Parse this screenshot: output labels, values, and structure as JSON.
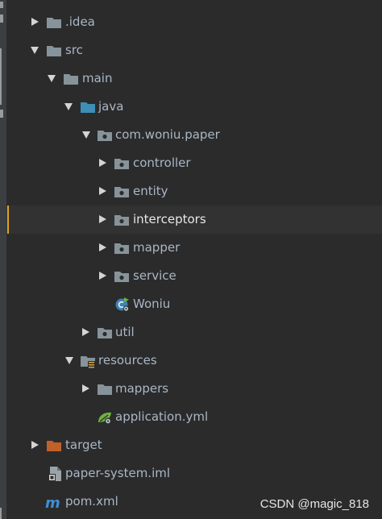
{
  "project_tree": {
    "items": [
      {
        "id": "idea",
        "label": ".idea",
        "expanded": false,
        "icon": "folder-icon"
      },
      {
        "id": "src",
        "label": "src",
        "expanded": true,
        "icon": "folder-icon"
      },
      {
        "id": "main",
        "label": "main",
        "expanded": true,
        "icon": "folder-icon"
      },
      {
        "id": "java",
        "label": "java",
        "expanded": true,
        "icon": "source-root-folder-icon"
      },
      {
        "id": "package",
        "label": "com.woniu.paper",
        "expanded": true,
        "icon": "package-icon"
      },
      {
        "id": "controller",
        "label": "controller",
        "expanded": false,
        "icon": "package-icon"
      },
      {
        "id": "entity",
        "label": "entity",
        "expanded": false,
        "icon": "package-icon"
      },
      {
        "id": "interceptors",
        "label": "interceptors",
        "expanded": false,
        "icon": "package-icon",
        "selected": true
      },
      {
        "id": "mapper",
        "label": "mapper",
        "expanded": false,
        "icon": "package-icon"
      },
      {
        "id": "service",
        "label": "service",
        "expanded": false,
        "icon": "package-icon"
      },
      {
        "id": "woniu",
        "label": "Woniu",
        "icon": "spring-boot-class-icon"
      },
      {
        "id": "util",
        "label": "util",
        "expanded": false,
        "icon": "package-icon"
      },
      {
        "id": "resources",
        "label": "resources",
        "expanded": true,
        "icon": "resources-folder-icon"
      },
      {
        "id": "mappers",
        "label": "mappers",
        "expanded": false,
        "icon": "folder-icon"
      },
      {
        "id": "application",
        "label": "application.yml",
        "icon": "spring-config-icon"
      },
      {
        "id": "target",
        "label": "target",
        "expanded": false,
        "icon": "excluded-folder-icon"
      },
      {
        "id": "iml",
        "label": "paper-system.iml",
        "icon": "iml-file-icon"
      },
      {
        "id": "pom",
        "label": "pom.xml",
        "icon": "maven-icon"
      }
    ]
  },
  "watermark": "CSDN @magic_818",
  "colors": {
    "background": "#2b2b2b",
    "selection": "#323232",
    "selection_marker": "#e0a31e",
    "folder": "#87939a",
    "source_folder": "#3d8fb6",
    "excluded_folder": "#c0612b"
  }
}
